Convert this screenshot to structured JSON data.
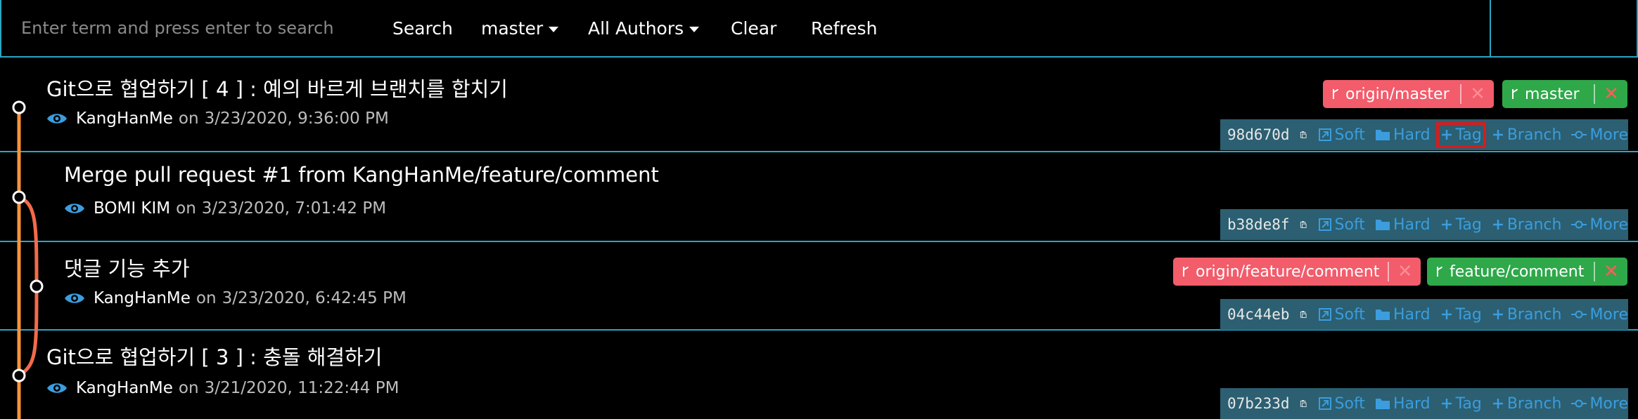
{
  "toolbar": {
    "search_placeholder": "Enter term and press enter to search",
    "search_label": "Search",
    "branch_filter": "master",
    "author_filter": "All Authors",
    "clear_label": "Clear",
    "refresh_label": "Refresh"
  },
  "actions_labels": {
    "soft": "Soft",
    "hard": "Hard",
    "tag": "Tag",
    "branch": "Branch",
    "more": "More"
  },
  "commits": [
    {
      "title": "Git으로 협업하기 [ 4 ] : 예의 바르게 브랜치를 합치기",
      "author": "KangHanMe",
      "on": "on",
      "date": "3/23/2020, 9:36:00 PM",
      "sha": "98d670d",
      "branches": [
        {
          "name": "origin/master",
          "remote": true
        },
        {
          "name": "master",
          "remote": false
        }
      ]
    },
    {
      "title": "Merge pull request #1 from KangHanMe/feature/comment",
      "author": "BOMI KIM",
      "on": "on",
      "date": "3/23/2020, 7:01:42 PM",
      "sha": "b38de8f",
      "branches": []
    },
    {
      "title": "댓글 기능 추가",
      "author": "KangHanMe",
      "on": "on",
      "date": "3/23/2020, 6:42:45 PM",
      "sha": "04c44eb",
      "branches": [
        {
          "name": "origin/feature/comment",
          "remote": true
        },
        {
          "name": "feature/comment",
          "remote": false
        }
      ]
    },
    {
      "title": "Git으로 협업하기 [ 3 ] : 충돌 해결하기",
      "author": "KangHanMe",
      "on": "on",
      "date": "3/21/2020, 11:22:44 PM",
      "sha": "07b233d",
      "branches": []
    }
  ],
  "colors": {
    "accent": "#2aa7c4",
    "action_bar": "#2b5f71",
    "action_link": "#3b9dde",
    "remote_branch": "#f25c6b",
    "local_branch": "#2fa84a",
    "graph_main": "#f7933c",
    "graph_branch": "#f26b4a",
    "highlight": "#d61d1d"
  },
  "icons": {
    "eye": "eye-icon",
    "clipboard": "clipboard-icon",
    "soft": "reset-soft-icon",
    "hard": "folder-icon",
    "tag": "plus-icon",
    "branch": "plus-icon",
    "more": "commit-icon",
    "branch_pill": "git-branch-icon",
    "delete": "close-icon"
  }
}
